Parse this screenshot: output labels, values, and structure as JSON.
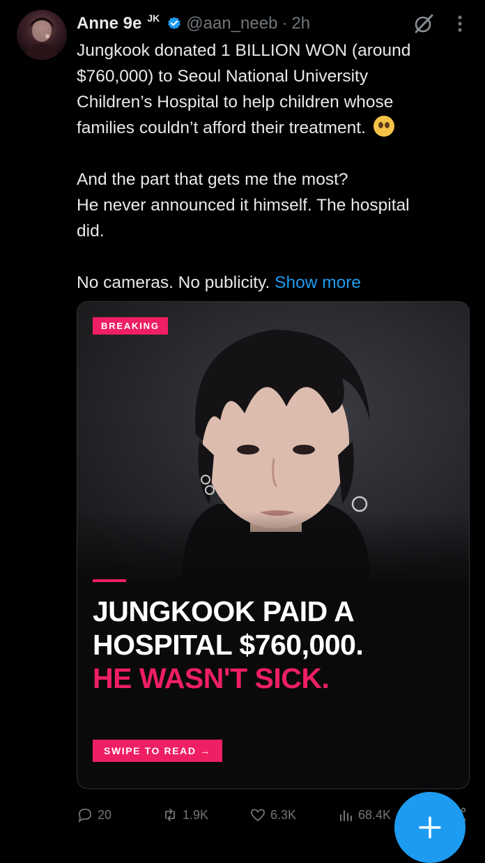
{
  "tweet": {
    "author_name": "Anne 9e",
    "author_sup": "JK",
    "handle": "@aan_neeb",
    "separator": "·",
    "time": "2h",
    "line1": "Jungkook donated 1 BILLION WON (around",
    "line2": "$760,000) to Seoul National University",
    "line3": "Children’s Hospital to help children whose",
    "line4": "families couldn’t afford their treatment.",
    "line5": "And the part that gets me the most?",
    "line6": "He never announced it himself. The hospital",
    "line7": "did.",
    "line8": "No cameras. No publicity.",
    "show_more": "Show more",
    "emoji_name": "pleading-face"
  },
  "card": {
    "badge": "BREAKING",
    "headline_1": "JUNGKOOK PAID A",
    "headline_2": "HOSPITAL $760,000.",
    "headline_3": "HE WASN'T SICK.",
    "swipe_label": "SWIPE TO READ →",
    "accent": "#ee1f62"
  },
  "actions": {
    "replies": "20",
    "reposts": "1.9K",
    "likes": "6.3K",
    "views": "68.4K"
  },
  "colors": {
    "background": "#000000",
    "text": "#e7e9ea",
    "muted": "#71767b",
    "link": "#1d9bf0",
    "verified": "#1d9bf0"
  },
  "icons": [
    "grok-icon",
    "more-icon",
    "verified-icon",
    "reply-icon",
    "repost-icon",
    "like-icon",
    "views-icon",
    "share-icon",
    "compose-plus-icon"
  ]
}
